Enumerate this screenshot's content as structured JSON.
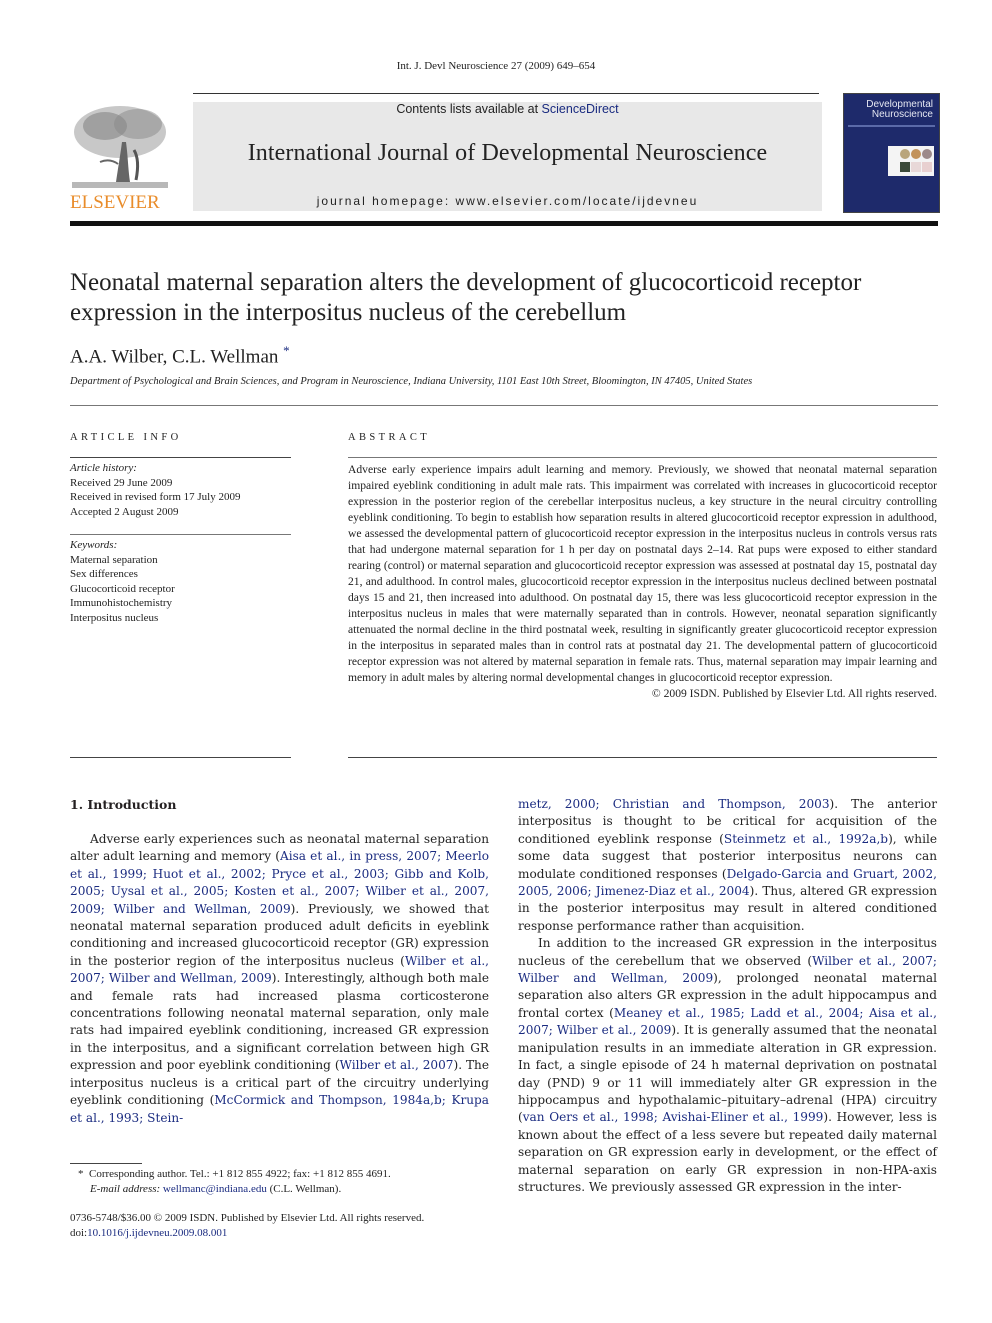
{
  "header": {
    "running_head": "Int. J. Devl Neuroscience 27 (2009) 649–654",
    "contents_prefix": "Contents lists available at ",
    "contents_link": "ScienceDirect",
    "journal_title": "International Journal of Developmental Neuroscience",
    "homepage": "journal homepage: www.elsevier.com/locate/ijdevneu",
    "publisher_logo_text": "ELSEVIER",
    "cover_title_line1": "Developmental",
    "cover_title_line2": "Neuroscience",
    "colors": {
      "publisher_orange": "#e98c2a",
      "link_blue": "#1a2b80",
      "cover_blue": "#1e2a6b",
      "banner_gray": "#e8e8e8"
    }
  },
  "article": {
    "title_line1": "Neonatal maternal separation alters the development of glucocorticoid receptor",
    "title_line2": "expression in the interpositus nucleus of the cerebellum",
    "authors": "A.A. Wilber, C.L. Wellman",
    "author_mark": "*",
    "affiliation": "Department of Psychological and Brain Sciences, and Program in Neuroscience, Indiana University, 1101 East 10th Street, Bloomington, IN 47405, United States"
  },
  "article_info": {
    "heading": "ARTICLE INFO",
    "history_label": "Article history:",
    "history": [
      "Received 29 June 2009",
      "Received in revised form 17 July 2009",
      "Accepted 2 August 2009"
    ],
    "keywords_label": "Keywords:",
    "keywords": [
      "Maternal separation",
      "Sex differences",
      "Glucocorticoid receptor",
      "Immunohistochemistry",
      "Interpositus nucleus"
    ]
  },
  "abstract": {
    "heading": "ABSTRACT",
    "text": "Adverse early experience impairs adult learning and memory. Previously, we showed that neonatal maternal separation impaired eyeblink conditioning in adult male rats. This impairment was correlated with increases in glucocorticoid receptor expression in the posterior region of the cerebellar interpositus nucleus, a key structure in the neural circuitry controlling eyeblink conditioning. To begin to establish how separation results in altered glucocorticoid receptor expression in adulthood, we assessed the developmental pattern of glucocorticoid receptor expression in the interpositus nucleus in controls versus rats that had undergone maternal separation for 1 h per day on postnatal days 2–14. Rat pups were exposed to either standard rearing (control) or maternal separation and glucocorticoid receptor expression was assessed at postnatal day 15, postnatal day 21, and adulthood. In control males, glucocorticoid receptor expression in the interpositus nucleus declined between postnatal days 15 and 21, then increased into adulthood. On postnatal day 15, there was less glucocorticoid receptor expression in the interpositus nucleus in males that were maternally separated than in controls. However, neonatal separation significantly attenuated the normal decline in the third postnatal week, resulting in significantly greater glucocorticoid receptor expression in the interpositus in separated males than in control rats at postnatal day 21. The developmental pattern of glucocorticoid receptor expression was not altered by maternal separation in female rats. Thus, maternal separation may impair learning and memory in adult males by altering normal developmental changes in glucocorticoid receptor expression.",
    "copyright": "© 2009 ISDN. Published by Elsevier Ltd. All rights reserved."
  },
  "intro": {
    "heading": "1. Introduction",
    "left_p1": [
      {
        "t": "Adverse early experiences such as neonatal maternal separation alter adult learning and memory ("
      },
      {
        "t": "Aisa et al., in press, 2007; Meerlo et al., 1999; Huot et al., 2002; Pryce et al., 2003; Gibb and Kolb, 2005; Uysal et al., 2005; Kosten et al., 2007; Wilber et al., 2007, 2009; Wilber and Wellman, 2009",
        "link": true
      },
      {
        "t": "). Previously, we showed that neonatal maternal separation produced adult deficits in eyeblink conditioning and increased glucocorticoid receptor (GR) expression in the posterior region of the interpositus nucleus ("
      },
      {
        "t": "Wilber et al., 2007; Wilber and Wellman, 2009",
        "link": true
      },
      {
        "t": "). Interestingly, although both male and female rats had increased plasma corticosterone concentrations following neonatal maternal separation, only male rats had impaired eyeblink conditioning, increased GR expression in the interpositus, and a significant correlation between high GR expression and poor eyeblink conditioning ("
      },
      {
        "t": "Wilber et al., 2007",
        "link": true
      },
      {
        "t": "). The interpositus nucleus is a critical part of the circuitry underlying eyeblink conditioning ("
      },
      {
        "t": "McCormick and Thompson, 1984a,b; Krupa et al., 1993; Stein-",
        "link": true
      }
    ],
    "right_p1": [
      {
        "t": "metz, 2000; Christian and Thompson, 2003",
        "link": true
      },
      {
        "t": "). The anterior interpositus is thought to be critical for acquisition of the conditioned eyeblink response ("
      },
      {
        "t": "Steinmetz et al., 1992a,b",
        "link": true
      },
      {
        "t": "), while some data suggest that posterior interpositus neurons can modulate conditioned responses ("
      },
      {
        "t": "Delgado-Garcia and Gruart, 2002, 2005, 2006; Jimenez-Diaz et al., 2004",
        "link": true
      },
      {
        "t": "). Thus, altered GR expression in the posterior interpositus may result in altered conditioned response performance rather than acquisition."
      }
    ],
    "right_p2": [
      {
        "t": "In addition to the increased GR expression in the interpositus nucleus of the cerebellum that we observed ("
      },
      {
        "t": "Wilber et al., 2007; Wilber and Wellman, 2009",
        "link": true
      },
      {
        "t": "), prolonged neonatal maternal separation also alters GR expression in the adult hippocampus and frontal cortex ("
      },
      {
        "t": "Meaney et al., 1985; Ladd et al., 2004; Aisa et al., 2007; Wilber et al., 2009",
        "link": true
      },
      {
        "t": "). It is generally assumed that the neonatal manipulation results in an immediate alteration in GR expression. In fact, a single episode of 24 h maternal deprivation on postnatal day (PND) 9 or 11 will immediately alter GR expression in the hippocampus and hypothalamic–pituitary–adrenal (HPA) circuitry ("
      },
      {
        "t": "van Oers et al., 1998; Avishai-Eliner et al., 1999",
        "link": true
      },
      {
        "t": "). However, less is known about the effect of a less severe but repeated daily maternal separation on GR expression early in development, or the effect of maternal separation on early GR expression in non-HPA-axis structures. We previously assessed GR expression in the inter-"
      }
    ]
  },
  "footnotes": {
    "corresponding_mark": "*",
    "corresponding": "Corresponding author. Tel.: +1 812 855 4922; fax: +1 812 855 4691.",
    "email_label": "E-mail address:",
    "email": "wellmanc@indiana.edu",
    "email_suffix": " (C.L. Wellman).",
    "issn_line": "0736-5748/$36.00 © 2009 ISDN. Published by Elsevier Ltd. All rights reserved.",
    "doi_prefix": "doi:",
    "doi": "10.1016/j.ijdevneu.2009.08.001"
  }
}
